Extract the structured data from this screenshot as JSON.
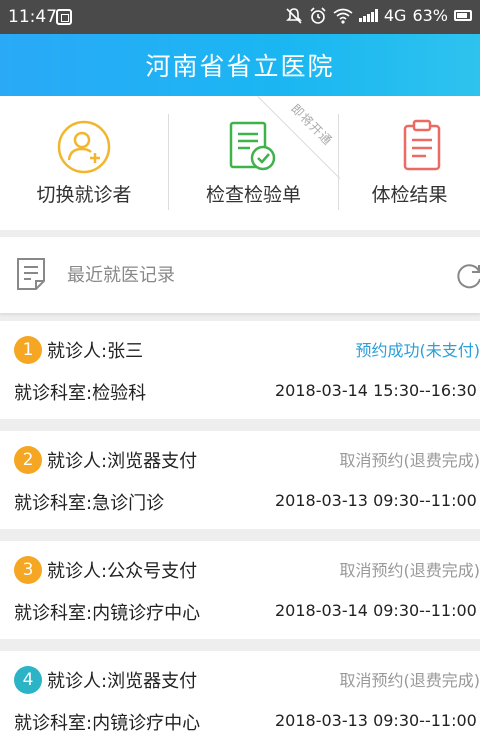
{
  "status_bar": {
    "time": "11:47",
    "network": "4G",
    "battery": "63%",
    "icons": [
      "scan-icon",
      "mute-icon",
      "alarm-icon",
      "wifi-icon",
      "signal-icon",
      "battery-icon"
    ]
  },
  "header": {
    "title": "河南省省立医院"
  },
  "quick_actions": [
    {
      "label": "切换就诊者",
      "icon": "switch-patient-icon",
      "color": "#f2b62e"
    },
    {
      "label": "检查检验单",
      "icon": "checklist-icon",
      "color": "#3fb24a",
      "ribbon": "即将开通"
    },
    {
      "label": "体检结果",
      "icon": "clipboard-icon",
      "color": "#ec6a62"
    }
  ],
  "recent": {
    "label": "最近就医记录",
    "icon": "document-icon",
    "refresh_icon": "refresh-icon"
  },
  "records": [
    {
      "index": "1",
      "patient": "就诊人:张三",
      "status": "预约成功(未支付)",
      "dept": "就诊科室:检验科",
      "time": "2018-03-14 15:30--16:30",
      "badge_color": "#f5a623",
      "status_color": "#2a9fd8"
    },
    {
      "index": "2",
      "patient": "就诊人:浏览器支付",
      "status": "取消预约(退费完成)",
      "dept": "就诊科室:急诊门诊",
      "time": "2018-03-13 09:30--11:00",
      "badge_color": "#f5a623",
      "status_color": "#999999"
    },
    {
      "index": "3",
      "patient": "就诊人:公众号支付",
      "status": "取消预约(退费完成)",
      "dept": "就诊科室:内镜诊疗中心",
      "time": "2018-03-14 09:30--11:00",
      "badge_color": "#f5a623",
      "status_color": "#999999"
    },
    {
      "index": "4",
      "patient": "就诊人:浏览器支付",
      "status": "取消预约(退费完成)",
      "dept": "就诊科室:内镜诊疗中心",
      "time": "2018-03-13 09:30--11:00",
      "badge_color": "#2bb3c6",
      "status_color": "#999999"
    }
  ]
}
